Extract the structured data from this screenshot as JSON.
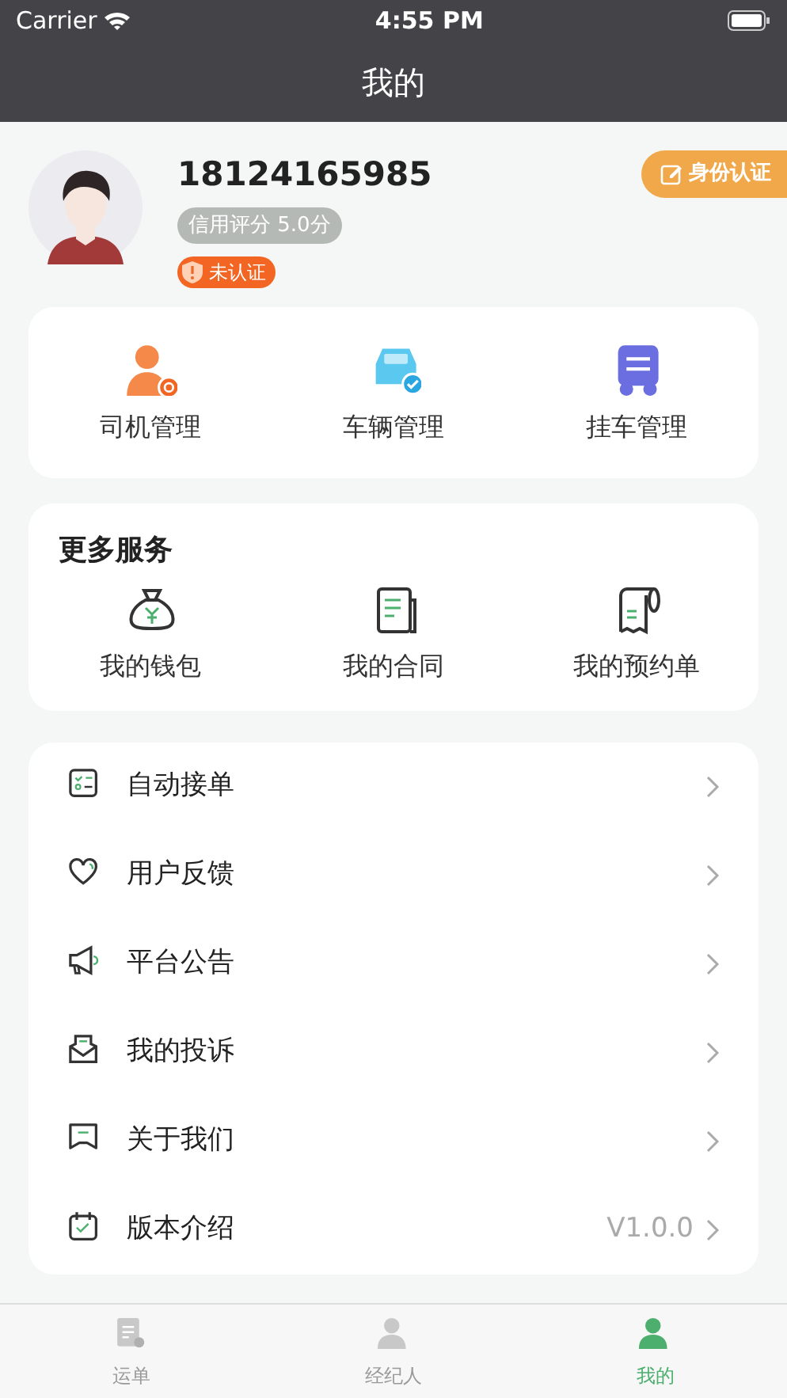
{
  "status_bar": {
    "carrier": "Carrier",
    "time": "4:55 PM"
  },
  "nav": {
    "title": "我的"
  },
  "profile": {
    "phone": "18124165985",
    "credit": "信用评分 5.0分",
    "verification": "未认证",
    "verify_button": "身份认证"
  },
  "management": [
    {
      "label": "司机管理",
      "kind": "driver"
    },
    {
      "label": "车辆管理",
      "kind": "vehicle"
    },
    {
      "label": "挂车管理",
      "kind": "trailer"
    }
  ],
  "services": {
    "title": "更多服务",
    "items": [
      {
        "label": "我的钱包",
        "kind": "wallet"
      },
      {
        "label": "我的合同",
        "kind": "contract"
      },
      {
        "label": "我的预约单",
        "kind": "booking"
      }
    ]
  },
  "menu": [
    {
      "label": "自动接单",
      "kind": "auto"
    },
    {
      "label": "用户反馈",
      "kind": "feedback"
    },
    {
      "label": "平台公告",
      "kind": "notice"
    },
    {
      "label": "我的投诉",
      "kind": "complaint"
    },
    {
      "label": "关于我们",
      "kind": "about"
    },
    {
      "label": "版本介绍",
      "kind": "version",
      "value": "V1.0.0"
    }
  ],
  "tabs": [
    {
      "label": "运单",
      "kind": "orders",
      "selected": false
    },
    {
      "label": "经纪人",
      "kind": "agent",
      "selected": false
    },
    {
      "label": "我的",
      "kind": "mine",
      "selected": true
    }
  ]
}
